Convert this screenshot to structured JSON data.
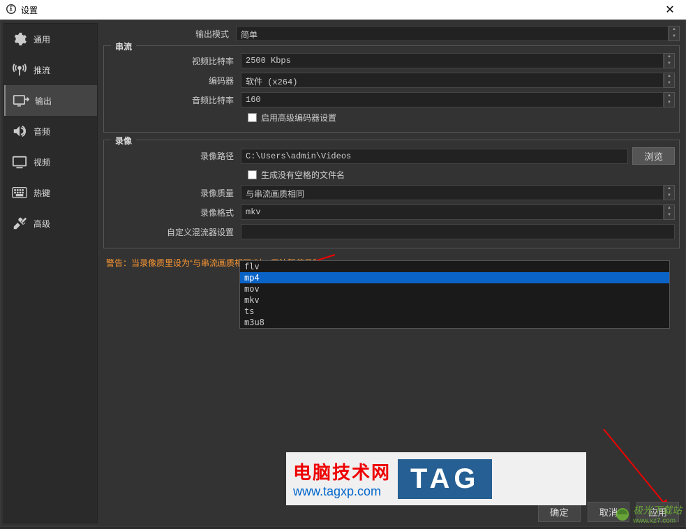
{
  "window": {
    "title": "设置"
  },
  "sidebar": {
    "items": [
      {
        "label": "通用"
      },
      {
        "label": "推流"
      },
      {
        "label": "输出"
      },
      {
        "label": "音频"
      },
      {
        "label": "视频"
      },
      {
        "label": "热键"
      },
      {
        "label": "高级"
      }
    ]
  },
  "output_mode": {
    "label": "输出模式",
    "value": "简单"
  },
  "stream_section": {
    "title": "串流",
    "video_bitrate_label": "视频比特率",
    "video_bitrate_value": "2500 Kbps",
    "encoder_label": "编码器",
    "encoder_value": "软件 (x264)",
    "audio_bitrate_label": "音频比特率",
    "audio_bitrate_value": "160",
    "advanced_encoder_label": "启用高级编码器设置"
  },
  "record_section": {
    "title": "录像",
    "path_label": "录像路径",
    "path_value": "C:\\Users\\admin\\Videos",
    "browse_btn": "浏览",
    "no_space_label": "生成没有空格的文件名",
    "quality_label": "录像质量",
    "quality_value": "与串流画质相同",
    "format_label": "录像格式",
    "format_value": "mkv",
    "muxer_label": "自定义混流器设置",
    "format_options": [
      "flv",
      "mp4",
      "mov",
      "mkv",
      "ts",
      "m3u8"
    ]
  },
  "warning_text": "警告：当录像质里设为“与串流画质相同”时，无法暂停录制。",
  "buttons": {
    "ok": "确定",
    "cancel": "取消",
    "apply": "应用"
  },
  "watermark1": {
    "title": "电脑技术网",
    "url": "www.tagxp.com",
    "tag": "TAG"
  },
  "watermark2": {
    "text": "极光下载站",
    "url": "www.xz7.com"
  }
}
